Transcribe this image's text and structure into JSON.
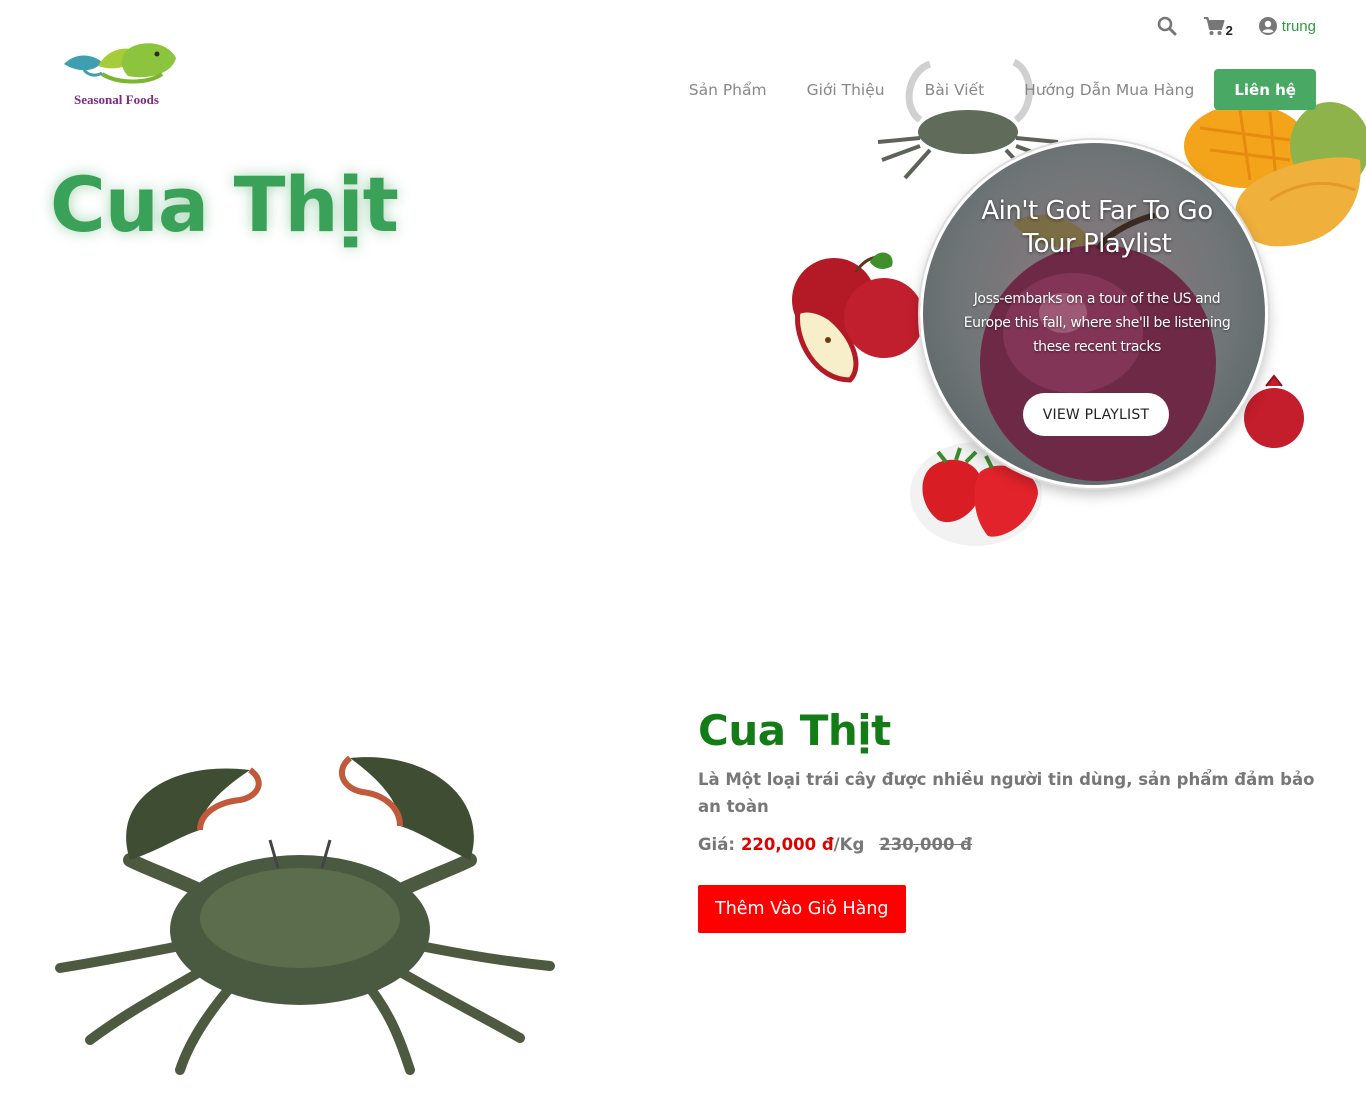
{
  "header": {
    "logo_text": "Seasonal Foods",
    "cart_count": "2",
    "user_name": "trung",
    "nav": [
      "Sản Phẩm",
      "Giới Thiệu",
      "Bài Viết",
      "Hướng Dẫn Mua Hàng"
    ],
    "contact_label": "Liên hệ"
  },
  "hero": {
    "title": "Cua Thịt",
    "card": {
      "title": "Ain't Got Far To Go Tour Playlist",
      "description": "Joss-embarks on a tour of the US and Europe this fall, where she'll be listening these recent tracks",
      "button": "VIEW PLAYLIST"
    }
  },
  "product": {
    "title": "Cua Thịt",
    "description": "Là Một loại trái cây được nhiều người tin dùng, sản phẩm đảm bảo an toàn",
    "price_label": "Giá:",
    "price": "220,000 đ",
    "unit": "/Kg",
    "old_price": "230,000 đ",
    "add_to_cart": "Thêm Vào Giỏ Hàng"
  },
  "colors": {
    "brand_green": "#3aa258",
    "product_title": "#137c16",
    "price_red": "#e00000",
    "cta_red": "#ff0000",
    "logo_purple": "#7b2a86"
  },
  "icons": [
    "search-icon",
    "cart-icon",
    "user-icon"
  ]
}
